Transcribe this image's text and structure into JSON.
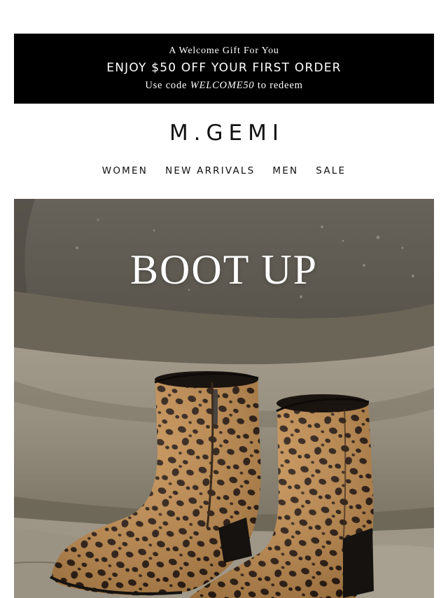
{
  "promo": {
    "eyebrow": "A Welcome Gift For You",
    "headline": "ENJOY $50 OFF YOUR FIRST ORDER",
    "redeem_prefix": "Use code ",
    "code": "WELCOME50",
    "redeem_suffix": " to redeem"
  },
  "brand": {
    "logo": "M.GEMI"
  },
  "nav": {
    "items": [
      {
        "label": "WOMEN"
      },
      {
        "label": "NEW ARRIVALS"
      },
      {
        "label": "MEN"
      },
      {
        "label": "SALE"
      }
    ]
  },
  "hero": {
    "title": "BOOT UP",
    "image": "leopard-print-ankle-boots-on-stone"
  },
  "colors": {
    "promo_bg": "#000000",
    "text": "#111111",
    "hero_title": "#ffffff",
    "stone": "#8f8777",
    "boot_base": "#c08a4b",
    "boot_spots": "#2a1a10"
  }
}
